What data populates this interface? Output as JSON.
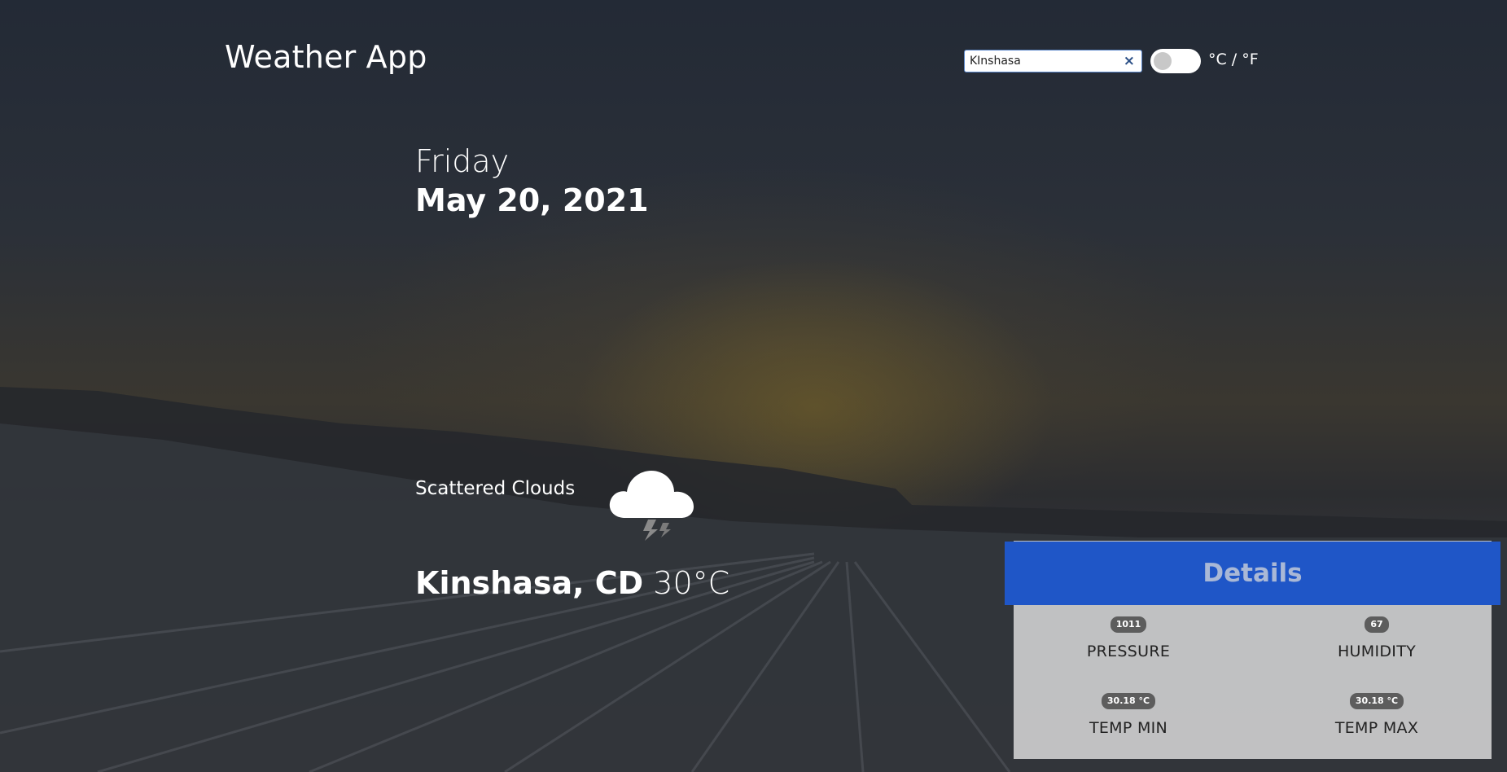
{
  "header": {
    "title": "Weather App"
  },
  "search": {
    "value": "KInshasa",
    "clear_icon": "×"
  },
  "unit_toggle": {
    "label": "°C / °F",
    "state": "off"
  },
  "date": {
    "day": "Friday",
    "full": "May 20, 2021"
  },
  "current": {
    "condition": "Scattered Clouds",
    "icon": "cloud-lightning-icon",
    "location": "Kinshasa, CD",
    "temperature": "30°C"
  },
  "details": {
    "title": "Details",
    "stats": [
      {
        "value": "1011",
        "label": "PRESSURE"
      },
      {
        "value": "67",
        "label": "HUMIDITY"
      },
      {
        "value": "30.18 °C",
        "label": "TEMP MIN"
      },
      {
        "value": "30.18 °C",
        "label": "TEMP MAX"
      }
    ]
  },
  "colors": {
    "details_header": "#1f56c7",
    "details_title": "#a9b8d6",
    "badge": "#5d5d5d",
    "text_light": "#ffffff"
  }
}
